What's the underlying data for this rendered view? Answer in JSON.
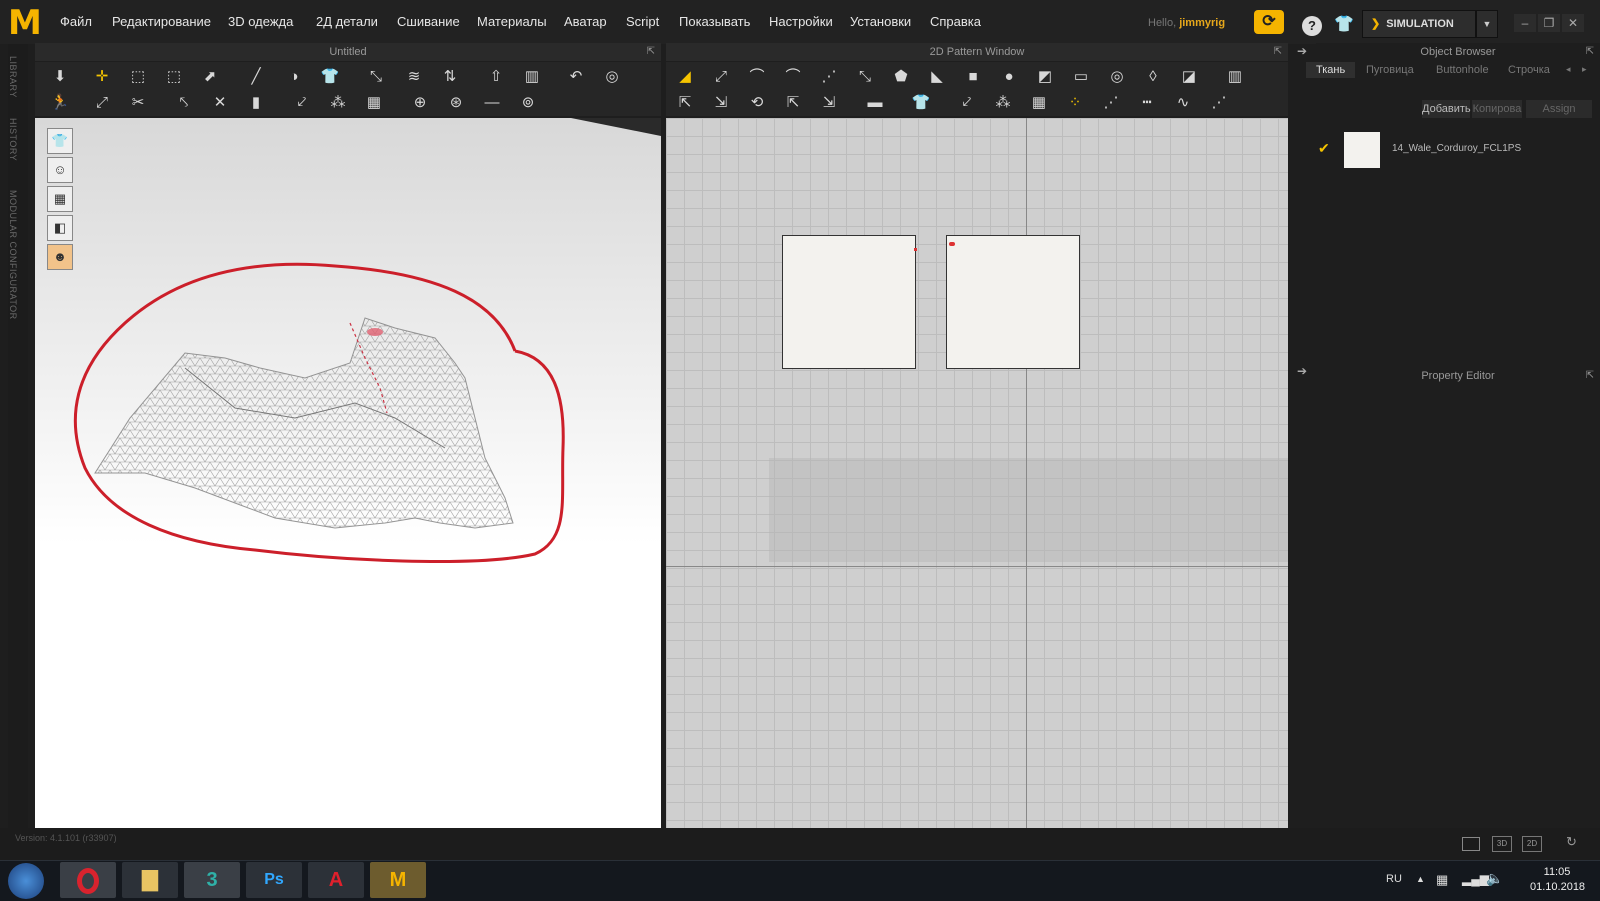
{
  "app": {
    "logo_letter": "M",
    "menu": [
      "Файл",
      "Редактирование",
      "3D одежда",
      "2Д детали",
      "Сшивание",
      "Материалы",
      "Аватар",
      "Script",
      "Показывать",
      "Настройки",
      "Установки",
      "Справка"
    ],
    "hello_prefix": "Hello,",
    "username": "jimmyrig",
    "mode_label": "SIMULATION"
  },
  "side_tabs": [
    "LIBRARY",
    "HISTORY",
    "MODULAR CONFIGURATOR"
  ],
  "view3d": {
    "title": "Untitled"
  },
  "view2d": {
    "title": "2D Pattern Window"
  },
  "object_browser": {
    "title": "Object Browser",
    "tabs": [
      "Ткань",
      "Пуговица",
      "Buttonhole",
      "Строчка"
    ],
    "active_tab": "Ткань",
    "buttons": [
      "Добавить",
      "Копирова",
      "Assign"
    ],
    "items": [
      {
        "name": "14_Wale_Corduroy_FCL1PS",
        "checked": true
      }
    ]
  },
  "property_editor": {
    "title": "Property Editor"
  },
  "footer": {
    "version": "Version: 4.1.101 (r33907)",
    "view_buttons": [
      "3D",
      "2D"
    ]
  },
  "taskbar": {
    "apps": [
      "opera",
      "explorer",
      "3ds max",
      "Ps",
      "A",
      "M"
    ],
    "app_labels": {
      "max": "3",
      "ps": "Ps",
      "acad": "A",
      "md": "M"
    },
    "lang": "RU",
    "time": "11:05",
    "date": "01.10.2018"
  },
  "colors": {
    "accent": "#f5b400",
    "annotation": "#cc1f2a"
  }
}
